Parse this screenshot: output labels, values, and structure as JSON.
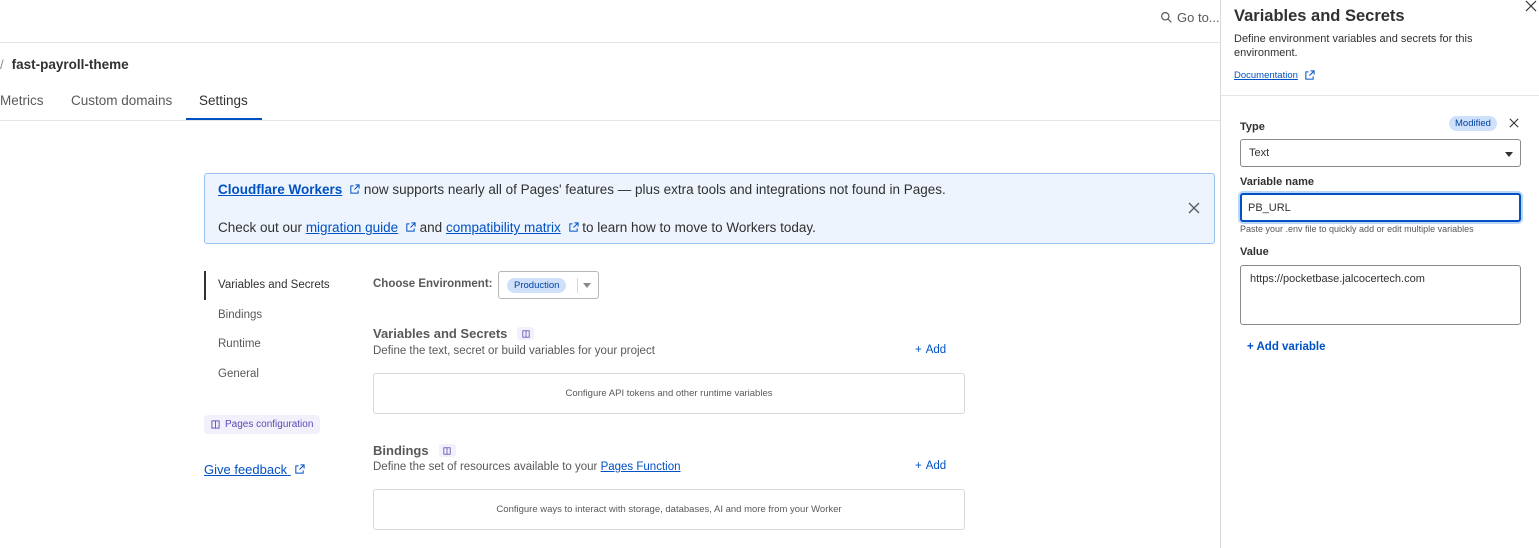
{
  "header": {
    "goto_label": "Go to..."
  },
  "breadcrumb": {
    "separator": "/",
    "project": "fast-payroll-theme"
  },
  "tabs": [
    {
      "label": "Metrics"
    },
    {
      "label": "Custom domains"
    },
    {
      "label": "Settings",
      "active": true
    }
  ],
  "banner": {
    "workers_link": "Cloudflare Workers",
    "line1_rest": "now supports nearly all of Pages' features — plus extra tools and integrations not found in Pages.",
    "line2_prefix": "Check out our",
    "migration_link": "migration guide",
    "and": "and",
    "compat_link": "compatibility matrix",
    "line2_suffix": "to learn how to move to Workers today."
  },
  "settings_nav": {
    "items": [
      {
        "label": "Variables and Secrets",
        "active": true
      },
      {
        "label": "Bindings"
      },
      {
        "label": "Runtime"
      },
      {
        "label": "General"
      }
    ],
    "pages_config": "Pages configuration",
    "feedback": "Give feedback"
  },
  "environment": {
    "label": "Choose Environment:",
    "selected": "Production"
  },
  "variables_section": {
    "title": "Variables and Secrets",
    "description": "Define the text, secret or build variables for your project",
    "add_label": "Add",
    "empty": "Configure API tokens and other runtime variables"
  },
  "bindings_section": {
    "title": "Bindings",
    "description_prefix": "Define the set of resources available to your",
    "description_link": "Pages Function",
    "add_label": "Add",
    "empty": "Configure ways to interact with storage, databases, AI and more from your Worker"
  },
  "drawer": {
    "title": "Variables and Secrets",
    "description": "Define environment variables and secrets for this environment.",
    "doc_link": "Documentation",
    "type_label": "Type",
    "modified_badge": "Modified",
    "type_value": "Text",
    "name_label": "Variable name",
    "name_value": "PB_URL",
    "hint": "Paste your .env file to quickly add or edit multiple variables",
    "value_label": "Value",
    "value_value": "https://pocketbase.jalcocertech.com",
    "add_variable": "+ Add variable"
  },
  "colors": {
    "accent": "#0051c3",
    "banner_bg": "#edf4fd",
    "badge_bg": "#cfe0fa"
  }
}
